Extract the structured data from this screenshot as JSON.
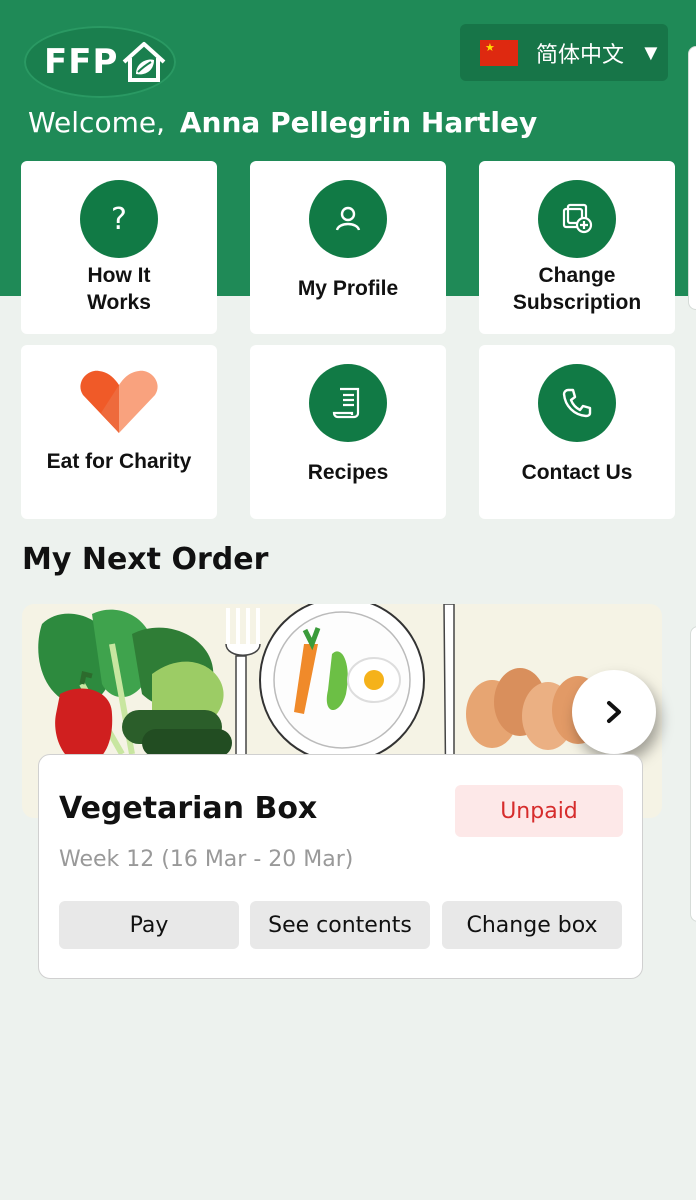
{
  "brand": {
    "logo_text": "FFP"
  },
  "language": {
    "label": "简体中文",
    "caret": "▼"
  },
  "welcome": {
    "greeting": "Welcome,",
    "name": "Anna Pellegrin Hartley"
  },
  "tiles": [
    {
      "label": "How It Works",
      "icon": "question-icon"
    },
    {
      "label": "My Profile",
      "icon": "person-icon"
    },
    {
      "label": "Change Subscription",
      "icon": "subscription-icon"
    },
    {
      "label": "Eat for Charity",
      "icon": "heart-icon"
    },
    {
      "label": "Recipes",
      "icon": "recipe-icon"
    },
    {
      "label": "Contact Us",
      "icon": "phone-icon"
    }
  ],
  "next_order": {
    "section_title": "My Next Order",
    "box_name": "Vegetarian Box",
    "status": "Unpaid",
    "week": "Week 12 (16 Mar - 20 Mar)",
    "actions": {
      "pay": "Pay",
      "contents": "See contents",
      "change": "Change box"
    }
  },
  "colors": {
    "brand_green": "#1f8a57",
    "icon_green": "#117a45",
    "status_red": "#d62c2c",
    "status_bg": "#fde8e8"
  }
}
